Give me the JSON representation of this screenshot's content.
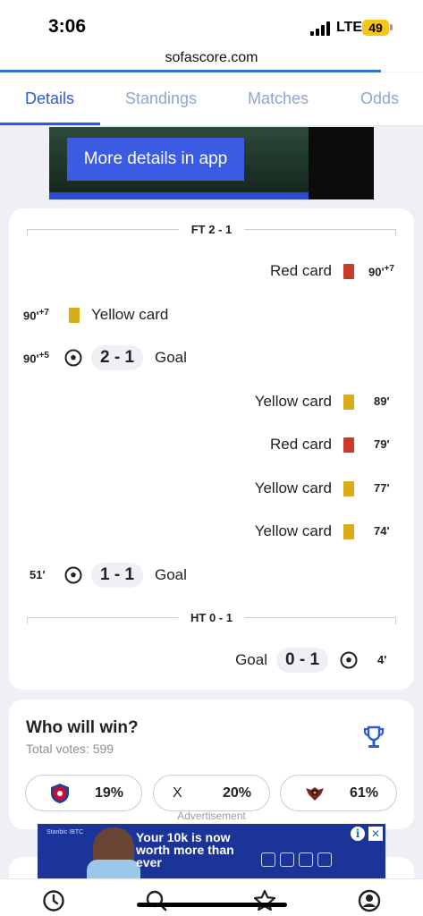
{
  "status_bar": {
    "time": "3:06",
    "network": "LTE",
    "battery": "49"
  },
  "browser": {
    "url": "sofascore.com",
    "load_progress_percent": 90
  },
  "tabs": [
    {
      "label": "Details",
      "active": true
    },
    {
      "label": "Standings",
      "active": false
    },
    {
      "label": "Matches",
      "active": false
    },
    {
      "label": "Odds",
      "active": false
    }
  ],
  "top_ad": {
    "button_label": "More details in app"
  },
  "incidents": {
    "ft_label": "FT 2 - 1",
    "ht_label": "HT 0 - 1",
    "events": [
      {
        "side": "away",
        "type": "red-card",
        "text": "Red card",
        "minute": "90'",
        "added": "+7"
      },
      {
        "side": "home",
        "type": "yellow-card",
        "text": "Yellow card",
        "minute": "90'",
        "added": "+7"
      },
      {
        "side": "home",
        "type": "goal",
        "text": "Goal",
        "score": "2 - 1",
        "minute": "90'",
        "added": "+5"
      },
      {
        "side": "away",
        "type": "yellow-card",
        "text": "Yellow card",
        "minute": "89'"
      },
      {
        "side": "away",
        "type": "red-card",
        "text": "Red card",
        "minute": "79'"
      },
      {
        "side": "away",
        "type": "yellow-card",
        "text": "Yellow card",
        "minute": "77'"
      },
      {
        "side": "away",
        "type": "yellow-card",
        "text": "Yellow card",
        "minute": "74'"
      },
      {
        "side": "home",
        "type": "goal",
        "text": "Goal",
        "score": "1 - 1",
        "minute": "51'"
      },
      {
        "side": "away",
        "type": "goal",
        "text": "Goal",
        "score": "0 - 1",
        "minute": "4'"
      }
    ]
  },
  "prediction": {
    "title": "Who will win?",
    "total_votes": "Total votes: 599",
    "options": [
      {
        "label": "",
        "percent": "19%"
      },
      {
        "label": "X",
        "percent": "20%"
      },
      {
        "label": "",
        "percent": "61%"
      }
    ]
  },
  "bottom_ad": {
    "label": "Advertisement",
    "brand": "Stanbic IBTC",
    "headline": "Your 10k is now worth more than ever",
    "info_glyph": "i",
    "close_glyph": "✕"
  },
  "colors": {
    "accent": "#2c5bd8",
    "yellow_card": "#d9ad1a",
    "red_card": "#c93a2b"
  },
  "bottom_nav": [
    "clock-icon",
    "search-icon",
    "star-icon",
    "profile-icon"
  ]
}
